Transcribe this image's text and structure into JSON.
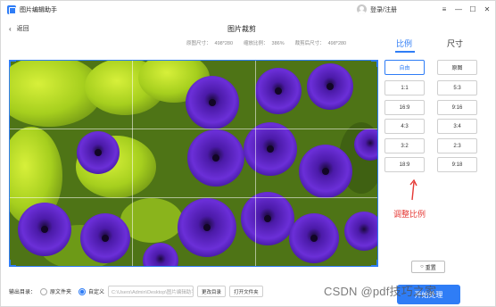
{
  "app": {
    "title": "图片编辑助手"
  },
  "user": {
    "login_label": "登录/注册"
  },
  "window_controls": {
    "menu": "≡",
    "minimize": "—",
    "maximize": "☐",
    "close": "✕"
  },
  "nav": {
    "back_label": "返回",
    "page_title": "图片裁剪"
  },
  "info": {
    "original_label": "原图尺寸：",
    "original_value": "498*280",
    "scale_label": "缩放比例：",
    "scale_value": "386%",
    "cropped_label": "裁剪后尺寸：",
    "cropped_value": "498*280"
  },
  "tabs": [
    {
      "label": "比例"
    },
    {
      "label": "尺寸"
    }
  ],
  "ratios": [
    {
      "label": "自由",
      "active": true
    },
    {
      "label": "原图"
    },
    {
      "label": "1:1"
    },
    {
      "label": "5:3"
    },
    {
      "label": "16:9"
    },
    {
      "label": "9:16"
    },
    {
      "label": "4:3"
    },
    {
      "label": "3:4"
    },
    {
      "label": "3:2"
    },
    {
      "label": "2:3"
    },
    {
      "label": "18:9"
    },
    {
      "label": "9:18"
    }
  ],
  "annotation": {
    "text": "调整比例"
  },
  "reset": {
    "label": "重置"
  },
  "footer": {
    "output_label": "输出目录：",
    "option_original": "原文件夹",
    "option_custom": "自定义",
    "path_placeholder": "C:\\Users\\Admin\\Desktop\\图片编辑助手",
    "change_dir": "更改目录",
    "open_folder": "打开文件夹"
  },
  "start": {
    "label": "开始处理"
  },
  "watermark": {
    "text": "CSDN @pdf技巧之家"
  },
  "colors": {
    "accent": "#2f7df6",
    "annotation": "#e53935"
  }
}
